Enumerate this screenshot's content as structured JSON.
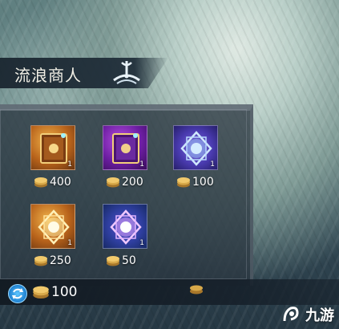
{
  "merchant": {
    "title": "流浪商人"
  },
  "items": [
    {
      "name": "orange-tome",
      "rarity_color": "#c8741f",
      "count": "1",
      "price": "400"
    },
    {
      "name": "purple-tome",
      "rarity_color": "#7a2ab0",
      "count": "1",
      "price": "200"
    },
    {
      "name": "blue-crystal",
      "rarity_color": "#4a3bb0",
      "count": "1",
      "price": "100"
    },
    {
      "name": "gold-crystal",
      "rarity_color": "#c8741f",
      "count": "1",
      "price": "250"
    },
    {
      "name": "violet-crystal",
      "rarity_color": "#2f3fa0",
      "count": "1",
      "price": "50"
    }
  ],
  "refresh": {
    "icon": "refresh-icon",
    "price": "100"
  },
  "colors": {
    "gold": "#e0b25a",
    "panel": "#2a3640"
  },
  "watermark": {
    "text": "九游"
  }
}
